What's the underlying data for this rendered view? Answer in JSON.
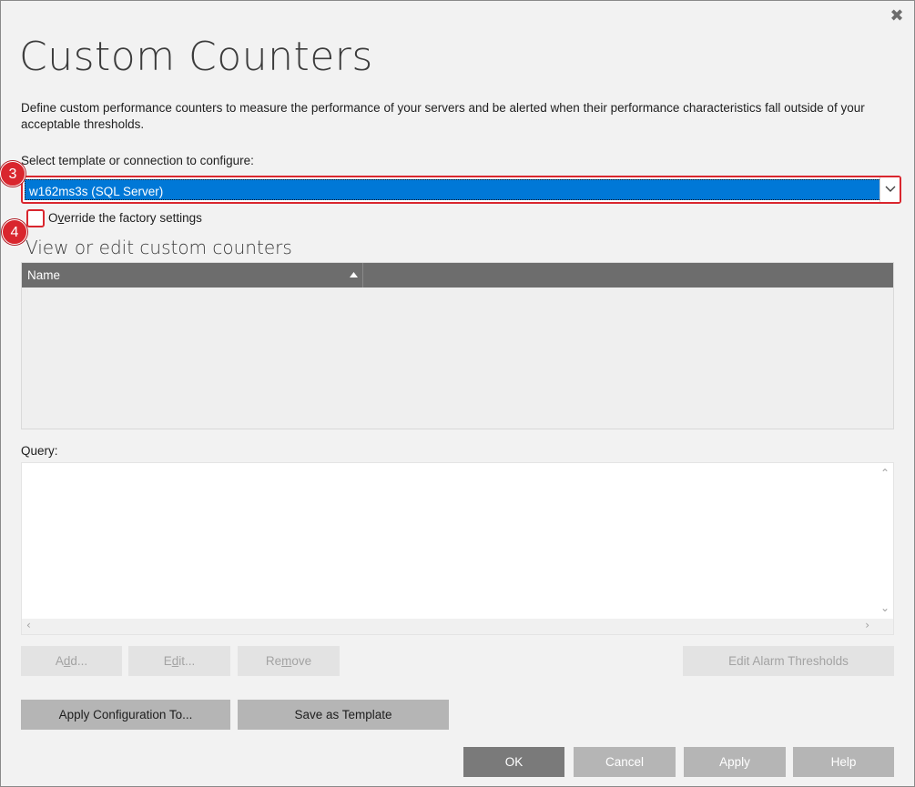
{
  "window": {
    "title": "Custom Counters",
    "close_glyph": "✖"
  },
  "description": "Define custom performance counters to measure the performance of your servers and be alerted when their performance characteristics fall outside of your acceptable thresholds.",
  "template_select": {
    "label": "Select template or connection to configure:",
    "selected_value": "w162ms3s (SQL Server)"
  },
  "override": {
    "label_pre": "O",
    "label_mnemonic": "v",
    "label_post": "erride the factory settings",
    "checked": false
  },
  "annotations": {
    "step_select": "3",
    "step_override": "4",
    "color": "#d9262e"
  },
  "counters": {
    "section_title": "View or edit custom counters",
    "columns": [
      "Name",
      ""
    ],
    "sort_direction": "ascending",
    "rows": []
  },
  "query": {
    "label": "Query:",
    "value": ""
  },
  "buttons": {
    "add_pre": "A",
    "add_mnemonic": "d",
    "add_post": "d...",
    "edit_pre": "E",
    "edit_mnemonic": "d",
    "edit_post": "it...",
    "remove_pre": "Re",
    "remove_mnemonic": "m",
    "remove_post": "ove",
    "edit_alarm": "Edit Alarm Thresholds",
    "apply_config": "Apply Configuration To...",
    "save_template": "Save as Template",
    "ok": "OK",
    "cancel": "Cancel",
    "apply": "Apply",
    "help": "Help"
  },
  "colors": {
    "selection": "#0078d7",
    "header": "#6d6d6d",
    "primary_button": "#7a7a7a"
  }
}
